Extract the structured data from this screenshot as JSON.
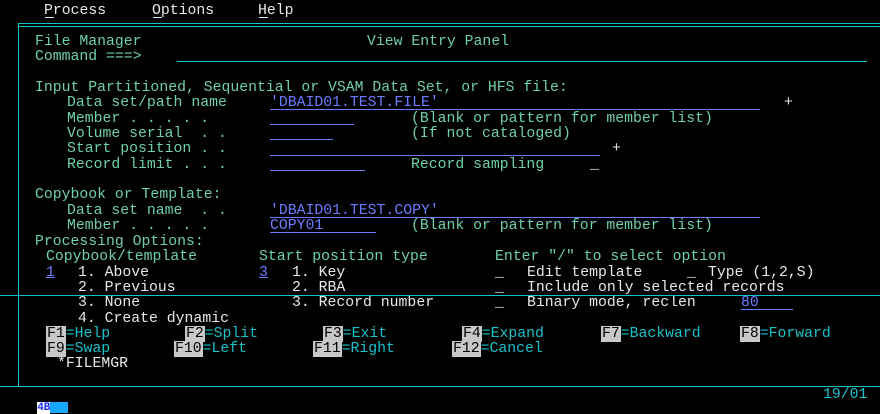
{
  "menu": {
    "items": [
      "Process",
      "Options",
      "Help"
    ]
  },
  "header": {
    "app_name": "File Manager",
    "panel_title": "View Entry Panel",
    "command_label": "Command ===>"
  },
  "input_section": {
    "heading": "Input Partitioned, Sequential or VSAM Data Set, or HFS file:",
    "dataset_label": "Data set/path name",
    "dataset_value": "'DBAID01.TEST.FILE'",
    "dataset_prompt": "+",
    "member_label": "Member . . . . .",
    "member_value": "",
    "member_hint": "(Blank or pattern for member list)",
    "volume_label": "Volume serial  . .",
    "volume_value": "",
    "volume_hint": "(If not cataloged)",
    "start_label": "Start position . .",
    "start_value": "",
    "start_prompt": "+",
    "record_limit_label": "Record limit . . .",
    "record_limit_value": "",
    "sampling_label": "Record sampling",
    "sampling_value": "_"
  },
  "copybook_section": {
    "heading": "Copybook or Template:",
    "dataset_label": "Data set name  . .",
    "dataset_value": "'DBAID01.TEST.COPY'",
    "member_label": "Member . . . . .",
    "member_value": "COPY01",
    "member_hint": "(Blank or pattern for member list)"
  },
  "processing": {
    "heading": "Processing Options:",
    "col1_head": "Copybook/template",
    "col2_head": "Start position type",
    "col3_head": "Enter \"/\" to select option",
    "copybook_value": "1",
    "copybook_options": [
      "1. Above",
      "2. Previous",
      "3. None",
      "4. Create dynamic"
    ],
    "start_type_value": "3",
    "start_type_options": [
      "1. Key",
      "2. RBA",
      "3. Record number"
    ],
    "opt_edit_mark": "_",
    "opt_edit_label": "Edit template",
    "opt_type_mark": "_",
    "opt_type_label": "Type (1,2,S)",
    "opt_include_mark": "_",
    "opt_include_label": "Include only selected records",
    "opt_binary_mark": "_",
    "opt_binary_label": "Binary mode, reclen",
    "opt_binary_value": "80"
  },
  "function_keys": {
    "row1": [
      {
        "key": "F1",
        "label": "=Help"
      },
      {
        "key": "F2",
        "label": "=Split"
      },
      {
        "key": "F3",
        "label": "=Exit"
      },
      {
        "key": "F4",
        "label": "=Expand"
      },
      {
        "key": "F7",
        "label": "=Backward"
      },
      {
        "key": "F8",
        "label": "=Forward"
      }
    ],
    "row2": [
      {
        "key": "F9",
        "label": "=Swap"
      },
      {
        "key": "F10",
        "label": "=Left"
      },
      {
        "key": "F11",
        "label": "=Right"
      },
      {
        "key": "F12",
        "label": "=Cancel"
      }
    ]
  },
  "footer_label": "*FILEMGR",
  "status_bar": {
    "session": "4B",
    "cursor_pos": "19/01"
  }
}
